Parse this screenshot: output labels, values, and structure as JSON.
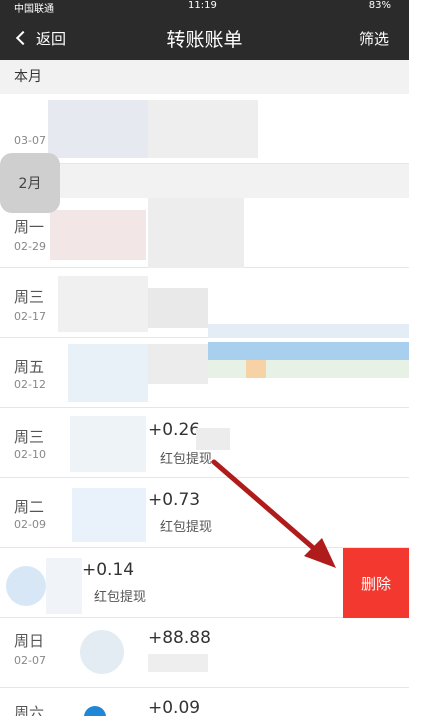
{
  "status": {
    "carrier": "中国联通",
    "time": "11:19",
    "battery": "83%"
  },
  "nav": {
    "back_label": "返回",
    "title": "转账账单",
    "filter_label": "筛选"
  },
  "sections": {
    "this_month": "本月",
    "feb": "2月"
  },
  "rows": [
    {
      "day": "周一",
      "date": "02-29"
    },
    {
      "day": "周三",
      "date": "02-17"
    },
    {
      "day": "周五",
      "date": "02-12"
    },
    {
      "day": "周三",
      "date": "02-10",
      "amount": "+0.26",
      "desc": "红包提现"
    },
    {
      "day": "周二",
      "date": "02-09",
      "amount": "+0.73",
      "desc": "红包提现"
    },
    {
      "amount": "+0.14",
      "desc": "红包提现"
    },
    {
      "day": "周日",
      "date": "02-07",
      "amount": "+88.88"
    },
    {
      "day": "周六",
      "amount": "+0.09"
    }
  ],
  "first_row": {
    "date": "03-07"
  },
  "delete_label": "删除",
  "colors": {
    "delete": "#f2382f",
    "nav_bg": "#2b2b2b",
    "arrow": "#b01c1c"
  }
}
